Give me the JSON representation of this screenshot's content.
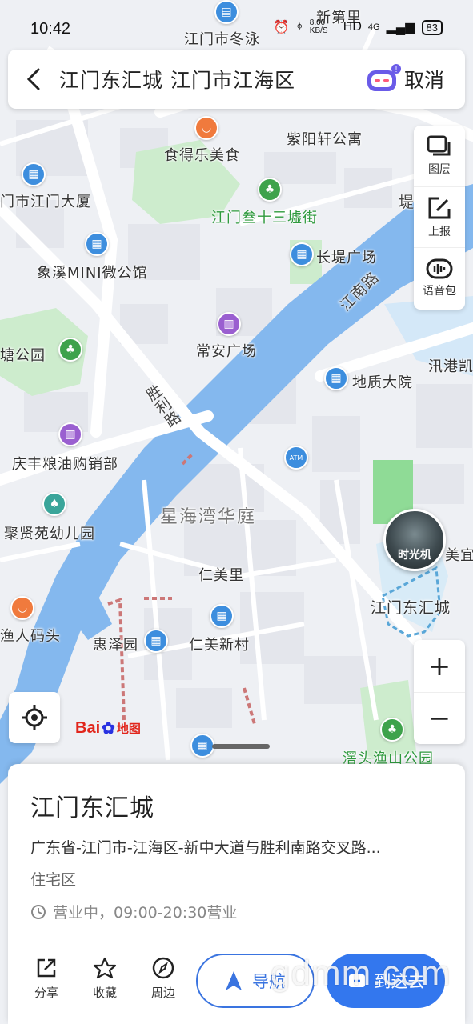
{
  "status_bar": {
    "time": "10:42",
    "net_speed": "8.00 KB/S",
    "hd": "HD",
    "signal": "4G",
    "battery": "83"
  },
  "search": {
    "query": "江门东汇城 江门市江海区",
    "cancel_label": "取消"
  },
  "toolbar": {
    "layers_label": "图层",
    "report_label": "上报",
    "voice_label": "语音包"
  },
  "map": {
    "labels": {
      "dongyong": "江门市冬泳",
      "xindiali": "新第里",
      "ziyangxuan": "紫阳轩公寓",
      "shidele": "食得乐美食",
      "jiangmendasha": "门市江门大厦",
      "sanshisanxu": "江门叁十三墟街",
      "xiangxi": "象溪MINI微公馆",
      "changdi": "长堤广场",
      "jiangnanlu": "江南路",
      "changan": "常安广场",
      "tanggongyuan": "塘公园",
      "shengli": "胜利路",
      "dizhi": "地质大院",
      "xungang": "汛港凯",
      "qingfeng": "庆丰粮油购销部",
      "atm": "ATM",
      "xinghaiwan": "星海湾华庭",
      "juxianyuan": "聚贤苑幼儿园",
      "shiguangji": "时光机",
      "meiyi": "美宜",
      "renmeili": "仁美里",
      "dongcheng": "江门东汇城",
      "matou": "渔人码头",
      "huizeyuan": "惠泽园",
      "renmeixincun": "仁美新村",
      "yushan": "滘头渔山公园",
      "baidu_logo_a": "Bai",
      "baidu_logo_b": "地图",
      "di": "堤"
    }
  },
  "place": {
    "name": "江门东汇城",
    "address": "广东省-江门市-江海区-新中大道与胜利南路交叉路...",
    "type": "住宅区",
    "hours": "营业中，09:00-20:30营业"
  },
  "actions": {
    "share": "分享",
    "favorite": "收藏",
    "nearby": "周边",
    "navigate": "导航",
    "go_here": "到这去"
  },
  "watermark": "gdmm.com",
  "colors": {
    "water": "#84b8ee",
    "park": "#cdeccd",
    "accent": "#3377ee"
  }
}
